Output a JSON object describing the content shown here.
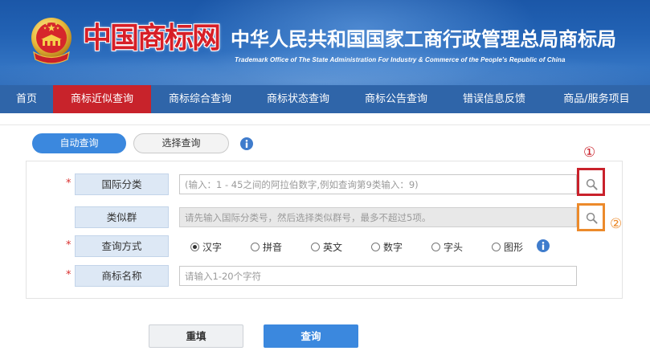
{
  "header": {
    "logo_text": "中国商标网",
    "title": "中华人民共和国国家工商行政管理总局商标局",
    "subtitle": "Trademark Office of The State Administration For Industry & Commerce of the People's Republic of China",
    "emblem_icon": "national-emblem-icon"
  },
  "nav": {
    "items": [
      {
        "label": "首页",
        "active": false
      },
      {
        "label": "商标近似查询",
        "active": true
      },
      {
        "label": "商标综合查询",
        "active": false
      },
      {
        "label": "商标状态查询",
        "active": false
      },
      {
        "label": "商标公告查询",
        "active": false
      },
      {
        "label": "错误信息反馈",
        "active": false
      },
      {
        "label": "商品/服务项目",
        "active": false
      }
    ]
  },
  "tabs": {
    "items": [
      {
        "label": "自动查询",
        "active": true
      },
      {
        "label": "选择查询",
        "active": false
      }
    ],
    "info_icon": "info-icon"
  },
  "form": {
    "required_mark": "*",
    "fields": [
      {
        "label": "国际分类",
        "required": true,
        "placeholder": "(输入：1 - 45之间的阿拉伯数字,例如查询第9类输入：9)",
        "value": "",
        "disabled": false,
        "action_icon": "search-icon"
      },
      {
        "label": "类似群",
        "required": false,
        "placeholder": "请先输入国际分类号，然后选择类似群号，最多不超过5项。",
        "value": "",
        "disabled": true,
        "action_icon": "search-icon"
      },
      {
        "label": "查询方式",
        "required": true
      },
      {
        "label": "商标名称",
        "required": true,
        "placeholder": "请输入1-20个字符",
        "value": "",
        "disabled": false
      }
    ],
    "query_mode": {
      "options": [
        {
          "label": "汉字",
          "selected": true
        },
        {
          "label": "拼音",
          "selected": false
        },
        {
          "label": "英文",
          "selected": false
        },
        {
          "label": "数字",
          "selected": false
        },
        {
          "label": "字头",
          "selected": false
        },
        {
          "label": "图形",
          "selected": false
        }
      ],
      "info_icon": "info-icon"
    }
  },
  "buttons": {
    "reset_label": "重填",
    "submit_label": "查询"
  },
  "annotations": {
    "marker_1": "①",
    "marker_2": "②"
  },
  "colors": {
    "brand_blue": "#2f65a9",
    "nav_active": "#c8232b",
    "primary_button": "#3b88de",
    "label_bg": "#dde8f5",
    "required": "#d9302f",
    "annotation_red": "#c9212b",
    "annotation_orange": "#ec8a2b",
    "info_blue": "#3f7ccc"
  }
}
